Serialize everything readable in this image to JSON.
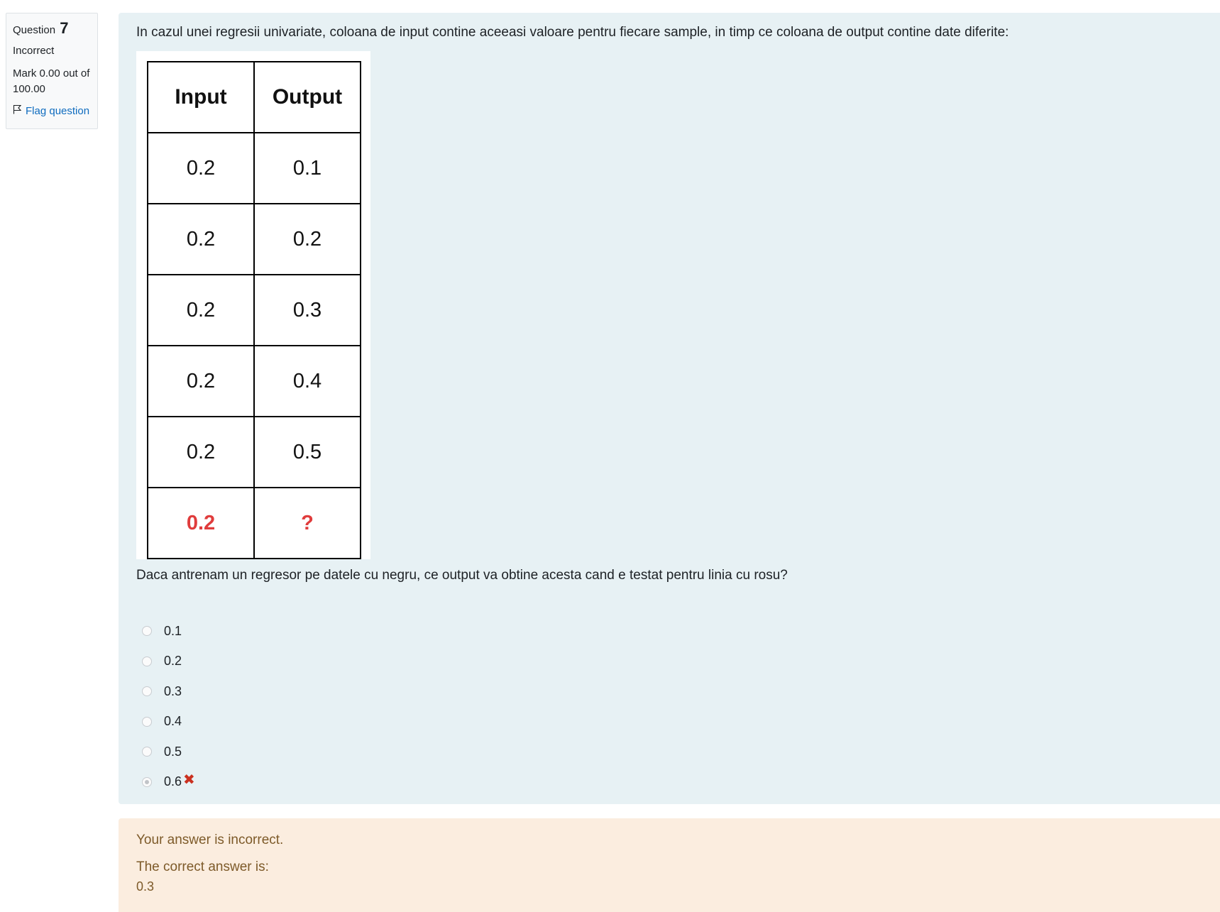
{
  "info": {
    "question_label": "Question",
    "question_number": "7",
    "state": "Incorrect",
    "grade": "Mark 0.00 out of 100.00",
    "flag_label": "Flag question"
  },
  "question": {
    "text": "In cazul unei regresii univariate, coloana de input contine aceeasi valoare pentru fiecare sample, in timp ce coloana de output contine date diferite:",
    "table": {
      "headers": [
        "Input",
        "Output"
      ],
      "rows": [
        [
          "0.2",
          "0.1"
        ],
        [
          "0.2",
          "0.2"
        ],
        [
          "0.2",
          "0.3"
        ],
        [
          "0.2",
          "0.4"
        ],
        [
          "0.2",
          "0.5"
        ]
      ],
      "test_row": [
        "0.2",
        "?"
      ],
      "test_row_color": "#e03c3c"
    },
    "prompt": "Daca antrenam un regresor pe datele cu negru, ce output va obtine acesta cand e testat pentru linia cu rosu?"
  },
  "answers": [
    {
      "label": "0.1",
      "selected": false
    },
    {
      "label": "0.2",
      "selected": false
    },
    {
      "label": "0.3",
      "selected": false
    },
    {
      "label": "0.4",
      "selected": false
    },
    {
      "label": "0.5",
      "selected": false
    },
    {
      "label": "0.6",
      "selected": true,
      "marked_incorrect": true
    }
  ],
  "feedback": {
    "result": "Your answer is incorrect.",
    "correct_label": "The correct answer is:",
    "correct_value": "0.3"
  },
  "colors": {
    "formulation_bg": "#e7f1f4",
    "feedback_bg": "#fbeddf",
    "feedback_text": "#7d5a29",
    "link": "#0f6cbf",
    "incorrect_icon": "#ca3120"
  }
}
